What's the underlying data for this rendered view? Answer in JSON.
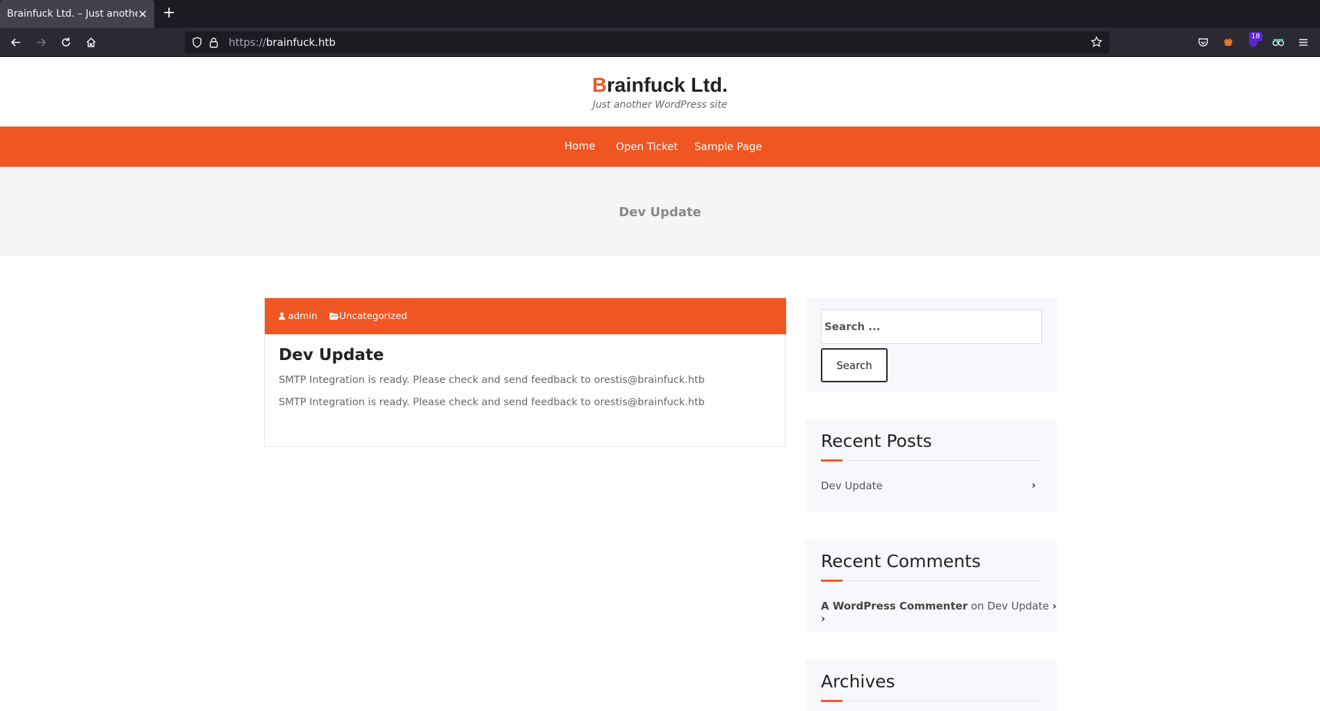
{
  "browser": {
    "tab_title": "Brainfuck Ltd. – Just another",
    "url_protocol": "https://",
    "url_host": "brainfuck.htb",
    "extension_badge": "18"
  },
  "site": {
    "title_first_letter": "B",
    "title_rest": "rainfuck Ltd.",
    "tagline": "Just another WordPress site"
  },
  "nav": {
    "items": [
      "Home",
      "Open Ticket",
      "Sample Page"
    ]
  },
  "banner": {
    "title": "Dev Update"
  },
  "post": {
    "author": "admin",
    "category": "Uncategorized",
    "title": "Dev Update",
    "lines": [
      "SMTP Integration is ready. Please check and send feedback to orestis@brainfuck.htb",
      "SMTP Integration is ready. Please check and send feedback to orestis@brainfuck.htb"
    ]
  },
  "sidebar": {
    "search_placeholder": "Search ...",
    "search_button": "Search",
    "recent_posts_title": "Recent Posts",
    "recent_posts": [
      "Dev Update"
    ],
    "recent_comments_title": "Recent Comments",
    "comment_author": "A WordPress Commenter",
    "comment_on": "on",
    "comment_post": "Dev Update",
    "archives_title": "Archives"
  },
  "colors": {
    "accent": "#ef5622",
    "chrome_dark": "#1c1b22"
  }
}
